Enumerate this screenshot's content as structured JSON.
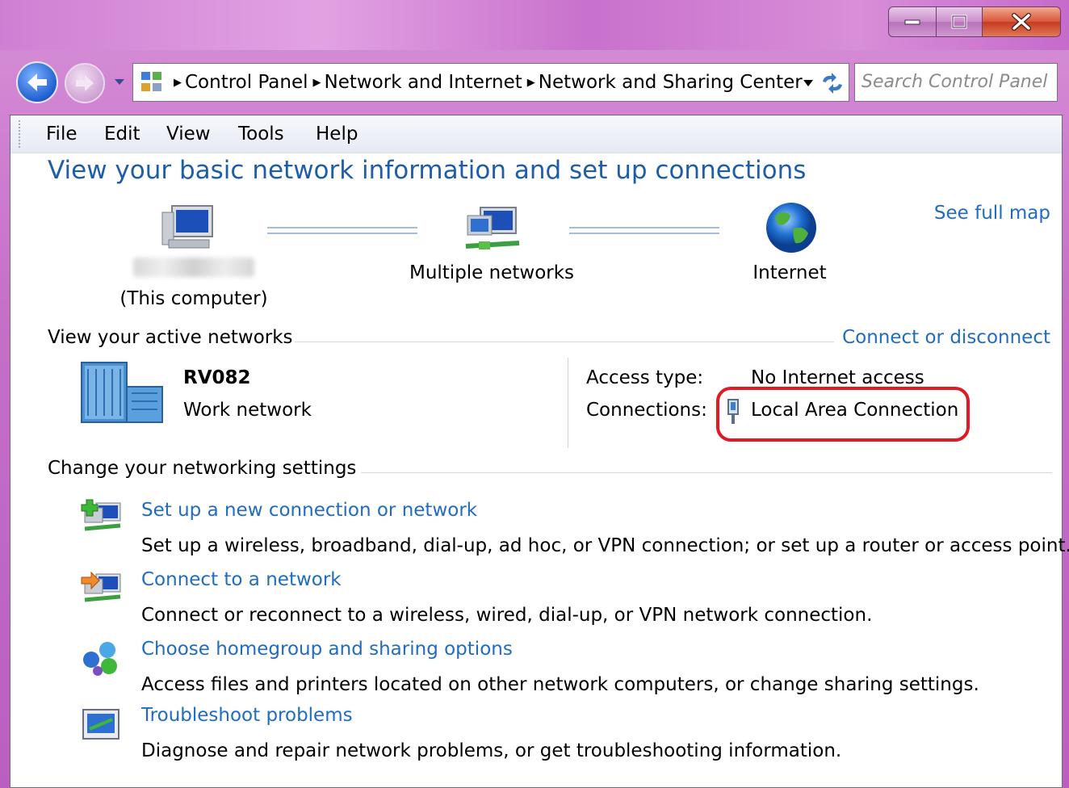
{
  "window": {
    "caption": {
      "minimize": "minimize",
      "maximize": "maximize",
      "close": "close"
    }
  },
  "nav": {
    "breadcrumbs": [
      "Control Panel",
      "Network and Internet",
      "Network and Sharing Center"
    ],
    "search_placeholder": "Search Control Panel"
  },
  "menu": [
    "File",
    "Edit",
    "View",
    "Tools",
    "Help"
  ],
  "page": {
    "title": "View your basic network information and set up connections",
    "see_full_map": "See full map"
  },
  "map": {
    "this_computer_label": "(This computer)",
    "multiple_networks": "Multiple networks",
    "internet": "Internet"
  },
  "active_networks": {
    "heading": "View your active networks",
    "connect_link": "Connect or disconnect",
    "network_name": "RV082",
    "network_type": "Work network",
    "access_type_label": "Access type:",
    "access_type_value": "No Internet access",
    "connections_label": "Connections:",
    "connection_value": "Local Area Connection"
  },
  "settings": {
    "heading": "Change your networking settings",
    "tasks": [
      {
        "link": "Set up a new connection or network",
        "desc": "Set up a wireless, broadband, dial-up, ad hoc, or VPN connection; or set up a router or access point."
      },
      {
        "link": "Connect to a network",
        "desc": "Connect or reconnect to a wireless, wired, dial-up, or VPN network connection."
      },
      {
        "link": "Choose homegroup and sharing options",
        "desc": "Access files and printers located on other network computers, or change sharing settings."
      },
      {
        "link": "Troubleshoot problems",
        "desc": "Diagnose and repair network problems, or get troubleshooting information."
      }
    ]
  },
  "colors": {
    "link": "#1f6cc0",
    "title": "#1e5ea8",
    "highlight": "#e01a24",
    "titlebar": "#c871cd"
  }
}
